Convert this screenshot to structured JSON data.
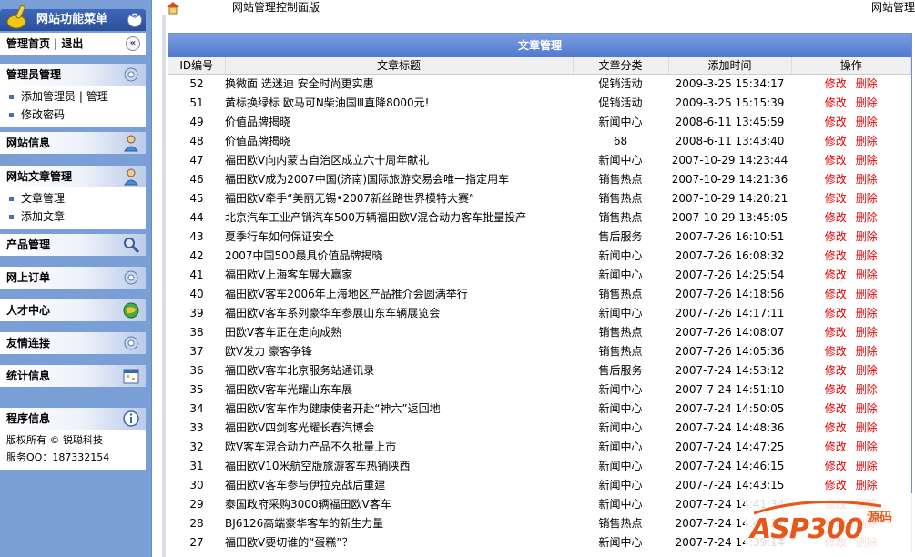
{
  "sidebar": {
    "menu_title": "网站功能菜单",
    "home": "管理首页",
    "sep": "|",
    "logout": "退出",
    "sections": [
      {
        "title": "管理员管理",
        "icon": "gear-icon",
        "items": [
          "添加管理员",
          "管理",
          "修改密码"
        ]
      },
      {
        "title": "网站信息",
        "icon": "user-icon"
      },
      {
        "title": "网站文章管理",
        "icon": "user-icon",
        "items": [
          "文章管理",
          "添加文章"
        ]
      },
      {
        "title": "产品管理",
        "icon": "magnifier-icon"
      },
      {
        "title": "网上订单",
        "icon": "gear-icon"
      },
      {
        "title": "人才中心",
        "icon": "globe-icon"
      },
      {
        "title": "友情连接",
        "icon": "gear-icon"
      },
      {
        "title": "统计信息",
        "icon": "calendar-icon"
      },
      {
        "title": "程序信息",
        "icon": "info-icon",
        "lines": [
          "版权所有 © 锐聪科技",
          "服务QQ：187332154"
        ]
      }
    ]
  },
  "topbar": {
    "title": "网站管理控制面版",
    "right": "网站管理"
  },
  "panel": {
    "title": "文章管理",
    "columns": [
      "ID编号",
      "文章标题",
      "文章分类",
      "添加时间",
      "操作"
    ],
    "edit_label": "修改",
    "delete_label": "删除",
    "rows": [
      {
        "id": "52",
        "title": "换微面 选迷迪 安全时尚更实惠",
        "cat": "促销活动",
        "time": "2009-3-25 15:34:17"
      },
      {
        "id": "51",
        "title": "黄标换绿标 欧马可N柴油国Ⅲ直降8000元!",
        "cat": "促销活动",
        "time": "2009-3-25 15:15:39"
      },
      {
        "id": "49",
        "title": "价值品牌揭晓",
        "cat": "新闻中心",
        "time": "2008-6-11 13:45:59"
      },
      {
        "id": "48",
        "title": "价值品牌揭晓",
        "cat": "68",
        "time": "2008-6-11 13:43:40"
      },
      {
        "id": "47",
        "title": "福田欧V向内蒙古自治区成立六十周年献礼",
        "cat": "新闻中心",
        "time": "2007-10-29 14:23:44"
      },
      {
        "id": "46",
        "title": "福田欧V成为2007中国(济南)国际旅游交易会唯一指定用车",
        "cat": "销售热点",
        "time": "2007-10-29 14:21:36"
      },
      {
        "id": "45",
        "title": "福田欧V牵手“美丽无锡•2007新丝路世界模特大赛”",
        "cat": "销售热点",
        "time": "2007-10-29 14:20:21"
      },
      {
        "id": "44",
        "title": "北京汽车工业产销汽车500万辆福田欧V混合动力客车批量投产",
        "cat": "销售热点",
        "time": "2007-10-29 13:45:05"
      },
      {
        "id": "43",
        "title": "夏季行车如何保证安全",
        "cat": "售后服务",
        "time": "2007-7-26 16:10:51"
      },
      {
        "id": "42",
        "title": "2007中国500最具价值品牌揭晓",
        "cat": "新闻中心",
        "time": "2007-7-26 16:08:32"
      },
      {
        "id": "41",
        "title": "福田欧V上海客车展大赢家",
        "cat": "新闻中心",
        "time": "2007-7-26 14:25:54"
      },
      {
        "id": "40",
        "title": "福田欧V客车2006年上海地区产品推介会圆满举行",
        "cat": "销售热点",
        "time": "2007-7-26 14:18:56"
      },
      {
        "id": "39",
        "title": "福田欧V客车系列豪华车参展山东车辆展览会",
        "cat": "新闻中心",
        "time": "2007-7-26 14:17:11"
      },
      {
        "id": "38",
        "title": "田欧V客车正在走向成熟",
        "cat": "销售热点",
        "time": "2007-7-26 14:08:07"
      },
      {
        "id": "37",
        "title": "欧V发力 豪客争锋",
        "cat": "销售热点",
        "time": "2007-7-26 14:05:36"
      },
      {
        "id": "36",
        "title": "福田欧V客车北京服务站通讯录",
        "cat": "售后服务",
        "time": "2007-7-24 14:53:12"
      },
      {
        "id": "35",
        "title": "福田欧V客车光耀山东车展",
        "cat": "新闻中心",
        "time": "2007-7-24 14:51:10"
      },
      {
        "id": "34",
        "title": "福田欧V客车作为健康使者开赴“神六”返回地",
        "cat": "新闻中心",
        "time": "2007-7-24 14:50:05"
      },
      {
        "id": "33",
        "title": "福田欧V四剑客光耀长春汽博会",
        "cat": "新闻中心",
        "time": "2007-7-24 14:48:36"
      },
      {
        "id": "32",
        "title": "欧V客车混合动力产品不久批量上市",
        "cat": "新闻中心",
        "time": "2007-7-24 14:47:25"
      },
      {
        "id": "31",
        "title": "福田欧V10米航空版旅游客车热销陕西",
        "cat": "新闻中心",
        "time": "2007-7-24 14:46:15"
      },
      {
        "id": "30",
        "title": "福田欧V客车参与伊拉克战后重建",
        "cat": "新闻中心",
        "time": "2007-7-24 14:43:15"
      },
      {
        "id": "29",
        "title": "泰国政府采购3000辆福田欧V客车",
        "cat": "新闻中心",
        "time": "2007-7-24 14:41:34"
      },
      {
        "id": "28",
        "title": "BJ6126高端豪华客车的新生力量",
        "cat": "销售热点",
        "time": "2007-7-24 14:40:22"
      },
      {
        "id": "27",
        "title": "福田欧V要切谁的“蛋糕”？",
        "cat": "新闻中心",
        "time": "2007-7-24 14:39:14"
      }
    ]
  },
  "watermark": {
    "logo": "ASP300",
    "cn_top": "源码",
    "cn_bottom": "",
    "accent": "#e8571a"
  }
}
